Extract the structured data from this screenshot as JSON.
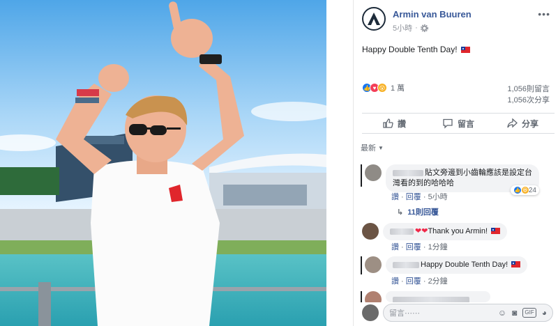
{
  "post": {
    "author": "Armin van Buuren",
    "time": "5小時",
    "text": "Happy Double Tenth Day!",
    "reactions_count": "1 萬",
    "shares": "1,056則留言",
    "comments_count": "1,056次分享"
  },
  "actions": {
    "like": "讚",
    "comment": "留言",
    "share": "分享"
  },
  "sort_label": "最新",
  "comments": [
    {
      "text": "貼文旁邊到小齒輪應該是設定台",
      "text2": "灣看的到的哈哈哈",
      "like": "讚",
      "reply": "回覆",
      "time": "5小時",
      "reaction_count": "24",
      "replies": "11則回覆"
    },
    {
      "text": "Thank you Armin!",
      "like": "讚",
      "reply": "回覆",
      "time": "1分鐘"
    },
    {
      "text": "Happy Double Tenth Day!",
      "like": "讚",
      "reply": "回覆",
      "time": "2分鐘"
    }
  ],
  "compose": {
    "placeholder": "留言⋯⋯"
  },
  "colors": {
    "link": "#385898",
    "flag_red": "#e0262c",
    "flag_blue": "#1a3a9a",
    "like_blue": "#1877f2"
  }
}
